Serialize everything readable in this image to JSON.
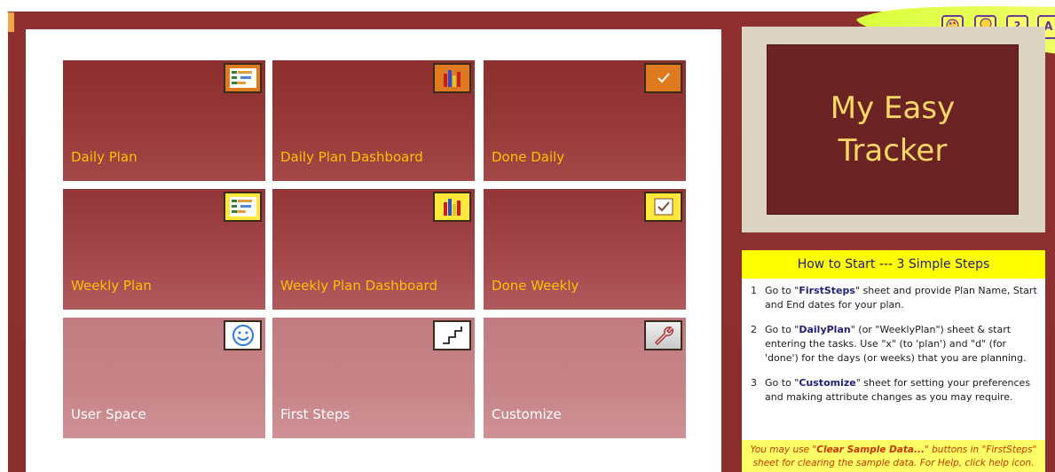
{
  "title": {
    "line1": "My Easy",
    "line2": "Tracker"
  },
  "tiles": [
    {
      "label": "Daily Plan",
      "icon": "gantt-icon"
    },
    {
      "label": "Daily Plan Dashboard",
      "icon": "bar-chart-icon"
    },
    {
      "label": "Done Daily",
      "icon": "checkmark-icon"
    },
    {
      "label": "Weekly Plan",
      "icon": "gantt-icon"
    },
    {
      "label": "Weekly Plan Dashboard",
      "icon": "bar-chart-icon"
    },
    {
      "label": "Done Weekly",
      "icon": "checkmark-icon"
    },
    {
      "label": "User Space",
      "icon": "smiley-icon"
    },
    {
      "label": "First Steps",
      "icon": "stairs-icon"
    },
    {
      "label": "Customize",
      "icon": "wrench-icon"
    }
  ],
  "toolbar": {
    "buttons": [
      {
        "name": "palette-button",
        "icon": "palette-icon"
      },
      {
        "name": "idea-button",
        "icon": "lightbulb-icon"
      },
      {
        "name": "help-button",
        "icon": "question-icon",
        "glyph": "?"
      },
      {
        "name": "about-button",
        "icon": "letter-a-icon",
        "glyph": "A"
      }
    ]
  },
  "steps": {
    "heading": "How to Start --- 3 Simple Steps",
    "items": [
      {
        "num": "1",
        "pre": "Go to \"",
        "bold": "FirstSteps",
        "post": "\" sheet and provide Plan Name, Start and End dates for your plan."
      },
      {
        "num": "2",
        "pre": "Go to \"",
        "bold": "DailyPlan",
        "post": "\" (or \"WeeklyPlan\") sheet & start entering the tasks. Use \"x\" (to 'plan') and \"d\" (for 'done') for the days (or weeks) that you are planning."
      },
      {
        "num": "3",
        "pre": "Go to \"",
        "bold": "Customize",
        "post": "\" sheet for setting your preferences and making attribute changes as you may require."
      }
    ],
    "note_pre": "You may use \"",
    "note_bold": "Clear Sample Data...",
    "note_post": "\" buttons in \"FirstSteps\" sheet for clearing the sample data. For Help, click help icon."
  },
  "colors": {
    "frame": "#8e3030",
    "accent_text": "#ffc000",
    "title_bg": "#6b2323",
    "title_text": "#ffd966",
    "steps_head": "#ffff00"
  }
}
